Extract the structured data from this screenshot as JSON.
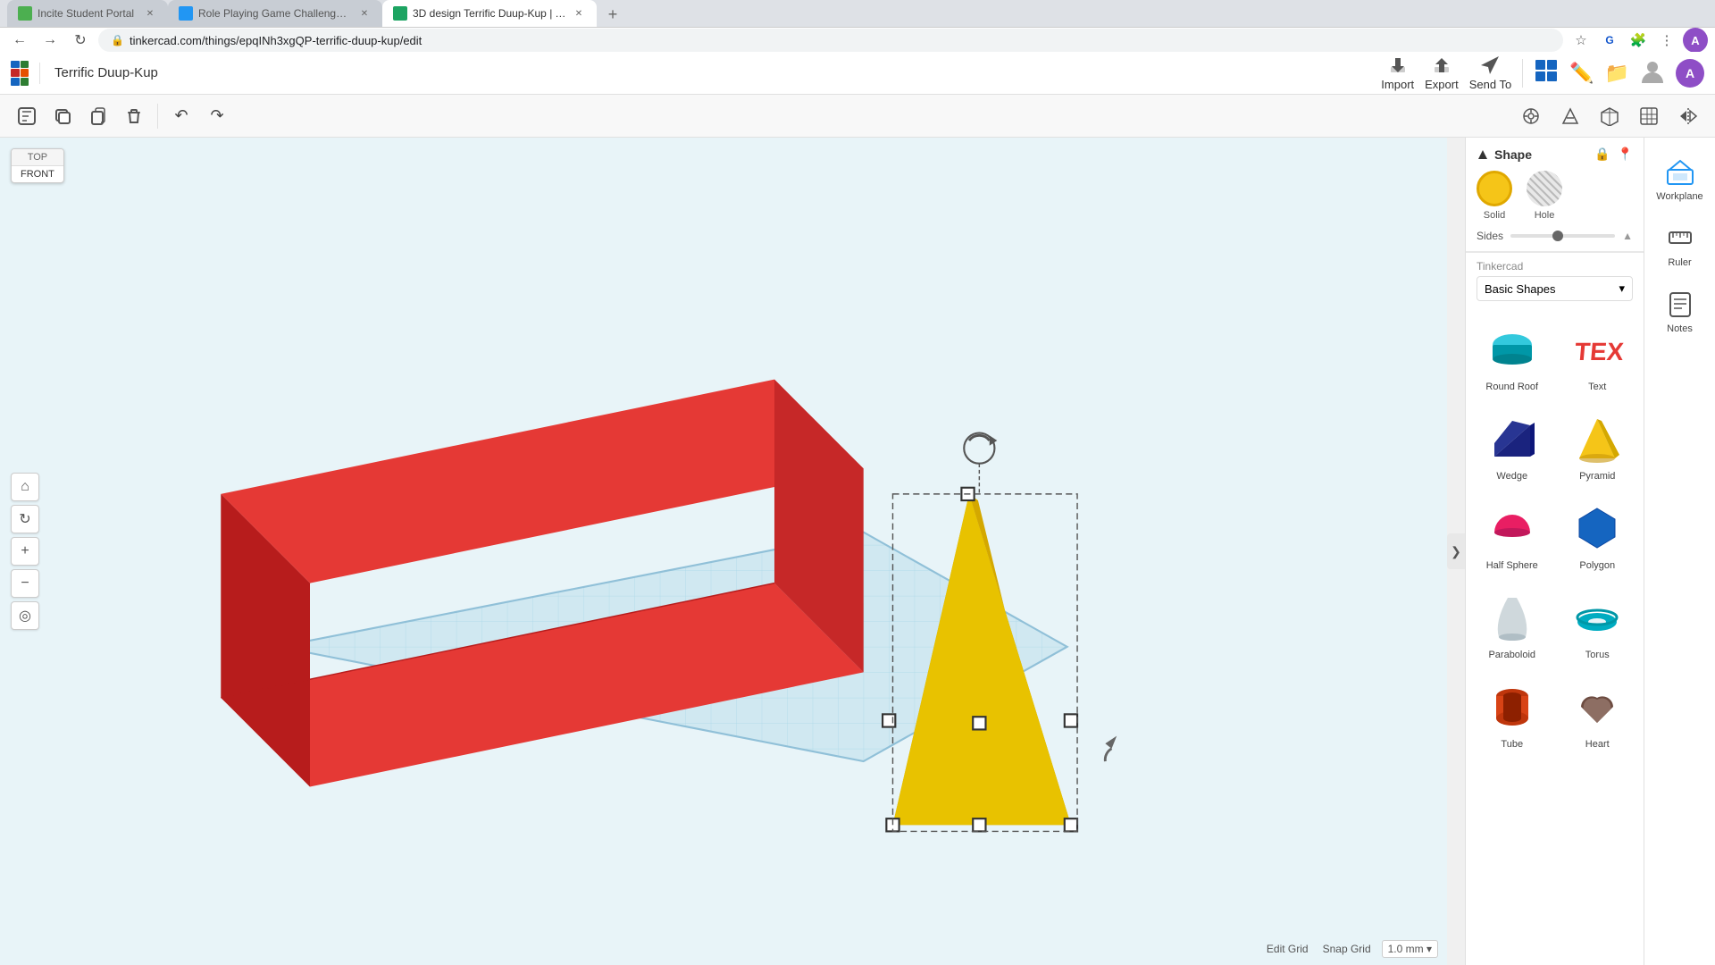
{
  "browser": {
    "tabs": [
      {
        "id": "tab1",
        "title": "Incite Student Portal",
        "favicon_color": "green",
        "active": false
      },
      {
        "id": "tab2",
        "title": "Role Playing Game Challenge -...",
        "favicon_color": "blue",
        "active": false
      },
      {
        "id": "tab3",
        "title": "3D design Terrific Duup-Kup | Ti...",
        "favicon_color": "tinkercad",
        "active": true
      }
    ],
    "url": "tinkercad.com/things/epqINh3xgQP-terrific-duup-kup/edit"
  },
  "app": {
    "title": "Terrific Duup-Kup",
    "toolbar": {
      "copy_label": "Copy",
      "paste_label": "Paste",
      "duplicate_label": "Duplicate",
      "delete_label": "Delete",
      "undo_label": "Undo",
      "redo_label": "Redo"
    }
  },
  "right_toolbar": {
    "import_label": "Import",
    "export_label": "Export",
    "send_to_label": "Send To",
    "workplane_label": "Workplane",
    "ruler_label": "Ruler",
    "notes_label": "Notes"
  },
  "shape_panel": {
    "title": "Shape",
    "solid_label": "Solid",
    "hole_label": "Hole",
    "sides_label": "Sides"
  },
  "tinkercad_section": {
    "label": "Tinkercad",
    "dropdown_value": "Basic Shapes"
  },
  "shapes": [
    {
      "name": "Round Roof",
      "color": "#00bcd4",
      "type": "round_roof"
    },
    {
      "name": "Text",
      "color": "#e53935",
      "type": "text"
    },
    {
      "name": "Wedge",
      "color": "#1a237e",
      "type": "wedge"
    },
    {
      "name": "Pyramid",
      "color": "#f5c518",
      "type": "pyramid"
    },
    {
      "name": "Half Sphere",
      "color": "#e91e63",
      "type": "half_sphere"
    },
    {
      "name": "Polygon",
      "color": "#1565c0",
      "type": "polygon"
    },
    {
      "name": "Paraboloid",
      "color": "#b0bec5",
      "type": "paraboloid"
    },
    {
      "name": "Torus",
      "color": "#00acc1",
      "type": "torus"
    },
    {
      "name": "Tube",
      "color": "#bf360c",
      "type": "tube"
    },
    {
      "name": "Heart",
      "color": "#6d4c41",
      "type": "heart"
    }
  ],
  "viewport": {
    "top_label": "TOP",
    "front_label": "FRONT"
  },
  "snap_grid": {
    "label": "Snap Grid",
    "edit_grid_label": "Edit Grid",
    "value": "1.0 mm"
  }
}
